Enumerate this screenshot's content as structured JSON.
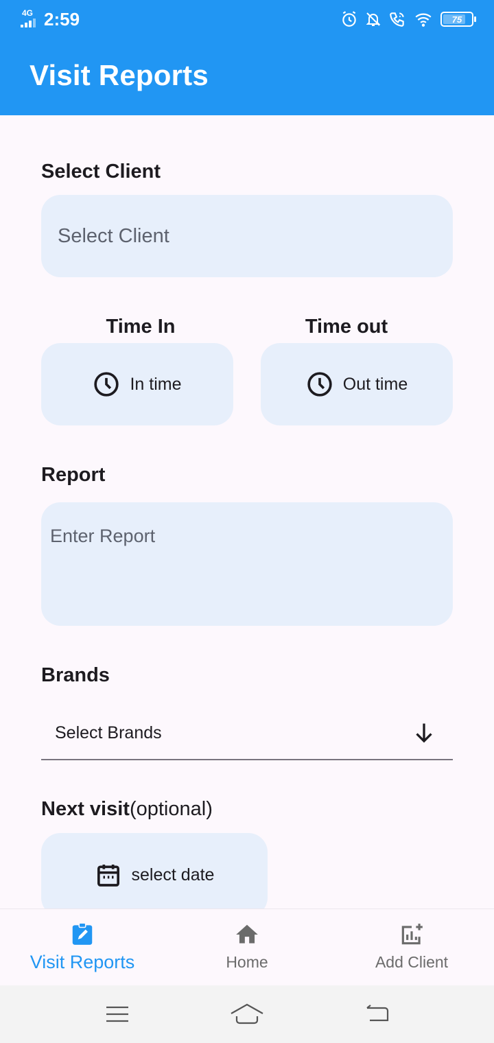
{
  "status_bar": {
    "network": "4G",
    "time": "2:59",
    "battery": "75",
    "icons": [
      "alarm-icon",
      "bell-off-icon",
      "wifi-call-icon",
      "wifi-icon",
      "battery-icon"
    ]
  },
  "app_bar": {
    "title": "Visit Reports",
    "color": "#2196f3"
  },
  "form": {
    "client": {
      "label": "Select Client",
      "placeholder": "Select Client"
    },
    "time_in": {
      "label": "Time In",
      "button": "In time"
    },
    "time_out": {
      "label": "Time out",
      "button": "Out time"
    },
    "report": {
      "label": "Report",
      "placeholder": "Enter Report"
    },
    "brands": {
      "label": "Brands",
      "value": "Select Brands"
    },
    "next_visit": {
      "label": "Next visit",
      "suffix": "(optional)",
      "button": "select date"
    },
    "field_color": "#e7effb"
  },
  "bottom_nav": {
    "items": [
      {
        "label": "Visit Reports",
        "icon": "edit-clipboard-icon",
        "active": true
      },
      {
        "label": "Home",
        "icon": "home-icon",
        "active": false
      },
      {
        "label": "Add Client",
        "icon": "add-chart-icon",
        "active": false
      }
    ],
    "active_color": "#2196f3"
  },
  "system_nav": {
    "icons": [
      "menu-icon",
      "home-outline-icon",
      "back-icon"
    ]
  }
}
